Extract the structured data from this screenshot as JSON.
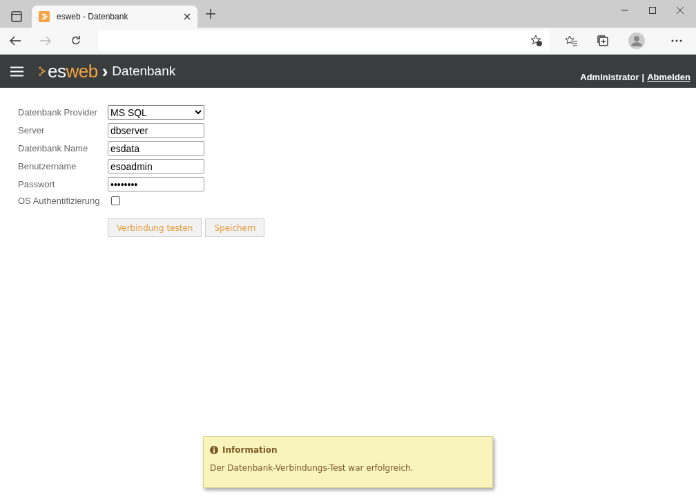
{
  "browser": {
    "tab_title": "esweb - Datenbank"
  },
  "header": {
    "logo_prefix": "es",
    "logo_suffix": "web",
    "separator": "›",
    "page_title": "Datenbank",
    "user": "Administrator",
    "divider": "|",
    "logout": "Abmelden"
  },
  "form": {
    "fields": [
      {
        "kind": "select",
        "label": "Datenbank Provider",
        "value": "MS SQL"
      },
      {
        "kind": "text",
        "label": "Server",
        "value": "dbserver"
      },
      {
        "kind": "text",
        "label": "Datenbank Name",
        "value": "esdata"
      },
      {
        "kind": "text",
        "label": "Benutzername",
        "value": "esoadmin"
      },
      {
        "kind": "text",
        "label": "Passwort",
        "value": "••••••••"
      },
      {
        "kind": "checkbox",
        "label": "OS Authentifizierung",
        "checked": false
      }
    ],
    "buttons": [
      "Verbindung testen",
      "Speichern"
    ]
  },
  "toast": {
    "title": "Information",
    "message": "Der Datenbank-Verbindungs-Test war erfolgreich."
  }
}
